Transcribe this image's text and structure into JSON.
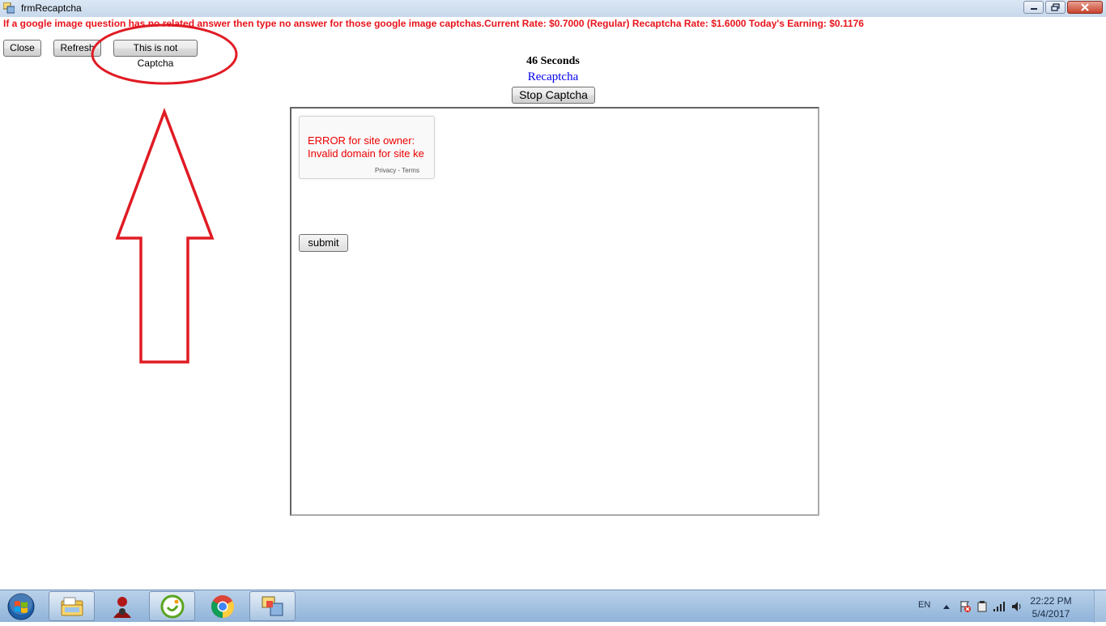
{
  "window": {
    "title": "frmRecaptcha"
  },
  "info_line": "If a google image question has no related answer then type no answer for those google image captchas.Current Rate: $0.7000 (Regular) Recaptcha Rate: $1.6000 Today's Earning: $0.1176",
  "toolbar": {
    "close_label": "Close",
    "refresh_label": "Refresh",
    "not_captcha_label": "This is not Captcha"
  },
  "timer_text": "46 Seconds",
  "recaptcha_label": "Recaptcha",
  "stop_captcha_label": "Stop Captcha",
  "web_content": {
    "error_line1": "ERROR for site owner:",
    "error_line2": "Invalid domain for site ke",
    "links": "Privacy - Terms",
    "submit_label": "submit"
  },
  "annotation": {
    "color": "#e01b24",
    "shapes": [
      "ellipse",
      "up-arrow"
    ]
  },
  "taskbar": {
    "items": [
      "start-orb",
      "file-explorer-icon",
      "agent-icon",
      "sogou-icon",
      "chrome-icon",
      "app-window-icon"
    ],
    "tray": {
      "language": "EN",
      "time": "22:22 PM",
      "date": "5/4/2017"
    }
  },
  "colors": {
    "info_text": "#e8141c",
    "link_blue": "#0000ee",
    "error_red": "#ee0000"
  }
}
